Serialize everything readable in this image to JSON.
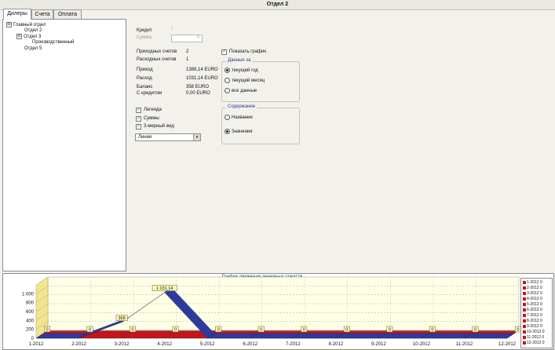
{
  "window": {
    "title": "Отдел 2"
  },
  "tabs": [
    {
      "label": "Дилеры",
      "active": true
    },
    {
      "label": "Счета",
      "active": false
    },
    {
      "label": "Оплата",
      "active": false
    }
  ],
  "tree": [
    {
      "label": "Главный отдел",
      "expander": "⊟"
    },
    {
      "label": "Отдел 2",
      "expander": ""
    },
    {
      "label": "Отдел 3",
      "expander": "⊟"
    },
    {
      "label": "Производственный",
      "expander": ""
    },
    {
      "label": "Отдел 5",
      "expander": ""
    }
  ],
  "form": {
    "credit_label": "Кредит",
    "credit_checkbox": "!",
    "sum_label": "Сумма",
    "sum_value": "0",
    "incoming_label": "Приходных счетов",
    "incoming_value": "2",
    "outgoing_label": "Расходных счетов",
    "outgoing_value": "1",
    "income_label": "Приход",
    "income_value": "1389,14 EURO",
    "expense_label": "Расход",
    "expense_value": "1031,14 EURO",
    "balance_label": "Баланс",
    "balance_value": "358 EURO",
    "with_credit_label": "С кредитом",
    "with_credit_value": "0,00 EURO",
    "legend_label": "Легенда",
    "sums_label": "Суммы",
    "view3d_label": "3-мерный вид",
    "chart_type_value": "Линии",
    "show_chart_label": "Показать график",
    "data_group_title": "Данные за",
    "data_options": [
      "текущий год",
      "текущий месяц",
      "все данные"
    ],
    "data_selected": 0,
    "content_group_title": "Содержание",
    "content_options": [
      "Название",
      "Значения"
    ],
    "content_selected": 1,
    "check_glyph": "✓",
    "dropdown_arrow": "▾"
  },
  "chart_data": {
    "type": "line",
    "title": "График движения денежных средств",
    "categories": [
      "1-2012",
      "2-2012",
      "3-2012",
      "4-2012",
      "5-2012",
      "6-2012",
      "7-2012",
      "8-2012",
      "9-2012",
      "10-2012",
      "11-2012",
      "12-2012"
    ],
    "series": [
      {
        "name": "",
        "values": [
          0,
          0,
          0,
          0,
          0,
          0,
          0,
          0,
          0,
          0,
          0,
          0
        ],
        "color": "#c4141c"
      },
      {
        "name": "",
        "values": [
          0,
          0,
          358,
          1031.14,
          0,
          0,
          0,
          0,
          0,
          0,
          0,
          0
        ],
        "color": "#2c3aa0"
      }
    ],
    "data_labels": [
      "0",
      "0",
      "0",
      "0",
      "0",
      "0",
      "0",
      "0",
      "0",
      "0",
      "0",
      "0",
      "358",
      "1 031,14"
    ],
    "yticks": [
      "0",
      "200",
      "400",
      "600",
      "800",
      "1 000"
    ],
    "ylim": [
      0,
      1200
    ],
    "legend": [
      "1-2012 0",
      "2-2012 0",
      "3-2012 0",
      "4-2012 0",
      "5-2012 0",
      "6-2012 0",
      "7-2012 0",
      "8-2012 0",
      "9-2012 0",
      "10-2012 0",
      "11-2012 0",
      "12-2012 0"
    ],
    "legend_position": "right",
    "grid": true,
    "three_d": true
  }
}
